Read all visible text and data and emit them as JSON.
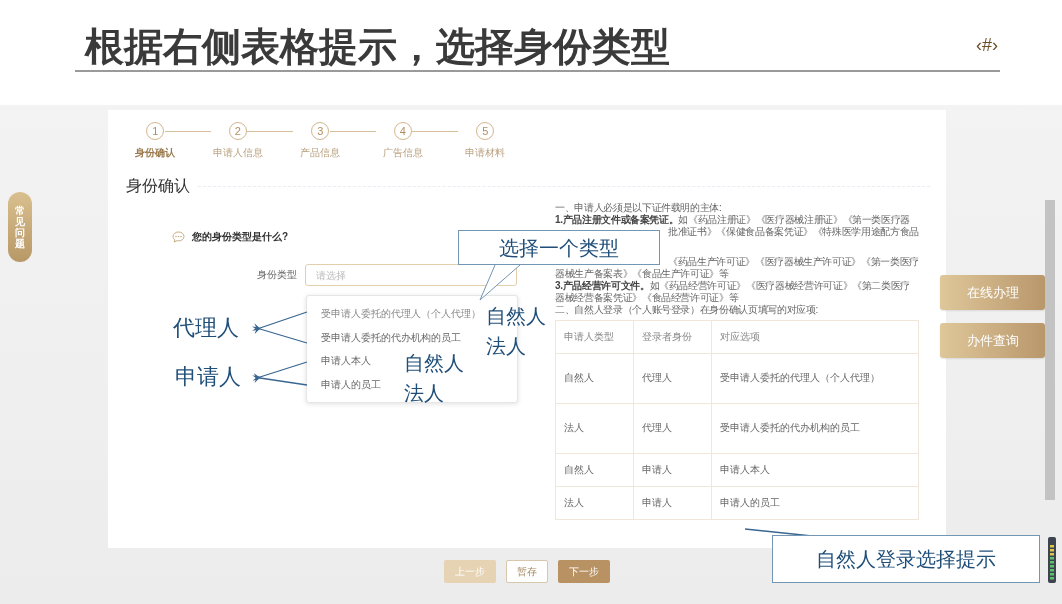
{
  "slide": {
    "title": "根据右侧表格提示，选择身份类型",
    "page_number": "‹#›"
  },
  "help_tab": "常见问题",
  "steps": [
    {
      "number": "1",
      "label": "身份确认",
      "selected": true
    },
    {
      "number": "2",
      "label": "申请人信息",
      "selected": false
    },
    {
      "number": "3",
      "label": "产品信息",
      "selected": false
    },
    {
      "number": "4",
      "label": "广告信息",
      "selected": false
    },
    {
      "number": "5",
      "label": "申请材料",
      "selected": false
    }
  ],
  "section_title": "身份确认",
  "form": {
    "question": "您的身份类型是什么?",
    "field_label": "身份类型",
    "placeholder": "请选择",
    "options": [
      "受申请人委托的代理人（个人代理）",
      "受申请人委托的代办机构的员工",
      "申请人本人",
      "申请人的员工"
    ]
  },
  "notice": {
    "lines": [
      {
        "kind": "full",
        "text": "一、申请人必须是以下证件载明的主体:"
      },
      {
        "kind": "full",
        "text": "**1.产品注册文件或备案凭证。**如《药品注册证》《医疗器械注册证》《第一类医疗器"
      },
      {
        "kind": "tail",
        "text": "批准证书》《保健食品备案凭证》《特殊医学用途配方食品"
      },
      {
        "kind": "tail",
        "text": "《药品生产许可证》《医疗器械生产许可证》《第一类医疗"
      },
      {
        "kind": "full",
        "text": "器械生产备案表》《食品生产许可证》等"
      },
      {
        "kind": "full",
        "text": "**3.产品经营许可文件。**如《药品经营许可证》《医疗器械经营许可证》《第二类医疗"
      },
      {
        "kind": "full",
        "text": "器械经营备案凭证》《食品经营许可证》等"
      },
      {
        "kind": "full",
        "text": "二、自然人登录（个人账号登录）在身份确认页填写的对应项:"
      }
    ]
  },
  "table": {
    "columns": [
      "申请人类型",
      "登录者身份",
      "对应选项"
    ],
    "rows": [
      [
        "自然人",
        "代理人",
        "受申请人委托的代理人（个人代理）"
      ],
      [
        "法人",
        "代理人",
        "受申请人委托的代办机构的员工"
      ],
      [
        "自然人",
        "申请人",
        "申请人本人"
      ],
      [
        "法人",
        "申请人",
        "申请人的员工"
      ]
    ]
  },
  "footer_buttons": [
    {
      "label": "上一步",
      "kind": "disabled"
    },
    {
      "label": "暂存",
      "kind": "outline"
    },
    {
      "label": "下一步",
      "kind": "primary"
    }
  ],
  "side_buttons": [
    "在线办理",
    "办件查询"
  ],
  "annotations": [
    {
      "kind": "box",
      "text": "选择一个类型"
    },
    {
      "kind": "label",
      "text": "代理人"
    },
    {
      "kind": "label",
      "text": "申请人"
    },
    {
      "kind": "label",
      "text": "自然人"
    },
    {
      "kind": "label",
      "text": "法人"
    },
    {
      "kind": "label",
      "text": "自然人"
    },
    {
      "kind": "label",
      "text": "法人"
    },
    {
      "kind": "box",
      "text": "自然人登录选择提示"
    }
  ]
}
